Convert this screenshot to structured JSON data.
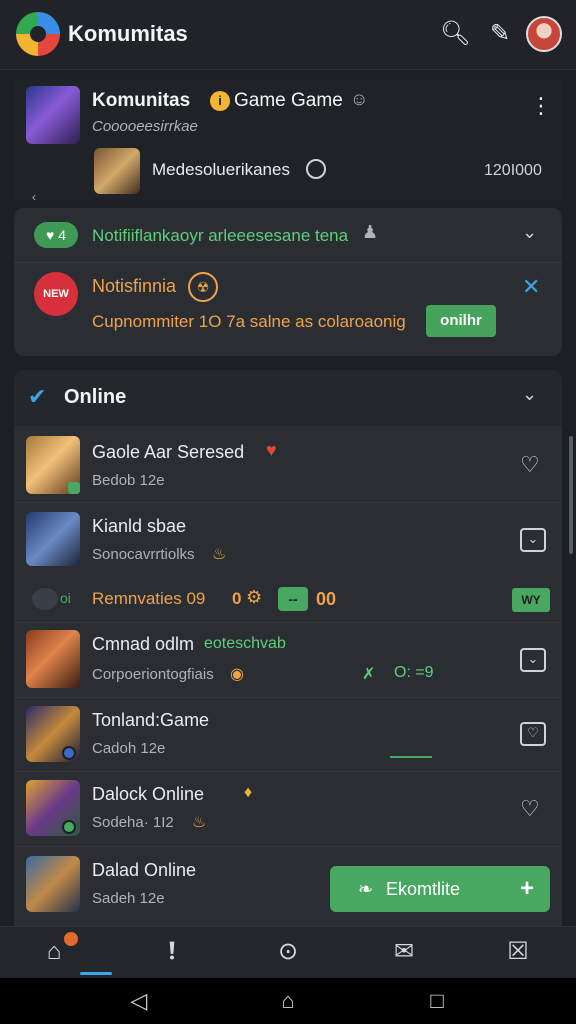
{
  "app": {
    "title": "Komumitas"
  },
  "group": {
    "title": "Komunitas",
    "title_suffix": "Game Game",
    "subtitle": "Cooooeesirrkae",
    "member_name": "Medesoluerikanes",
    "member_count": "120I000"
  },
  "notification": {
    "line1": "Notifiiflankaoyr arleeesesane tena",
    "heart_label": "♥ 4",
    "badge_text": "NEW",
    "title": "Notisfinnia",
    "body": "Cupnommiter 1O 7a salne as colaroaonig",
    "confirm_label": "onilhr"
  },
  "online": {
    "header": "Online",
    "items": [
      {
        "name": "Gaole Aar Seresed",
        "sub": "Bedob 12e",
        "icon": "heart-outline-icon"
      },
      {
        "name": "Kianld sbae",
        "sub": "Sonocavrrtiolks",
        "icon": "square-chevron-icon"
      },
      {
        "name": "Cmnad odlm",
        "name_suffix": "eoteschvab",
        "sub": "Corpoeriontogfiais",
        "icon": "square-chevron-icon"
      },
      {
        "name": "Tonland:Game",
        "sub": "Cadoh 12e",
        "icon": "square-heart-icon"
      },
      {
        "name": "Dalock Online",
        "sub": "Sodeha· 1I2",
        "icon": "heart-outline-icon"
      },
      {
        "name": "Dalad Online",
        "sub": "Sadeh 12e",
        "icon": "none"
      }
    ],
    "reminder": {
      "label": "Remnvaties 09",
      "count_a": "0",
      "pill": "--",
      "count_b": "00",
      "tag": "WY"
    },
    "row3_meta": {
      "a": "✗",
      "b": "O: =9"
    }
  },
  "fab": {
    "label": "Ekomtlite"
  },
  "colors": {
    "accent_green": "#48a862",
    "accent_blue": "#3aa6e6",
    "alert_red": "#d6303a",
    "warn_orange": "#f0a24a"
  }
}
